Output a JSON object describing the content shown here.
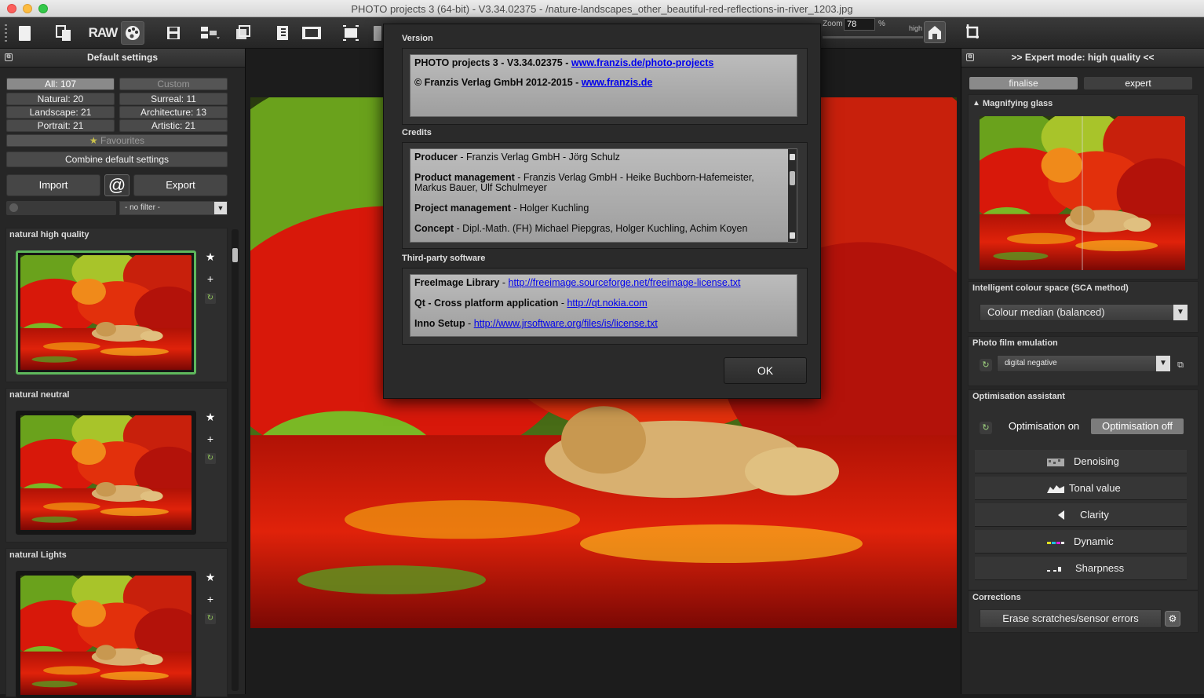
{
  "window": {
    "title": "PHOTO projects 3 (64-bit) - V3.34.02375 - /nature-landscapes_other_beautiful-red-reflections-in-river_1203.jpg"
  },
  "toolbar": {
    "raw_label": "RAW",
    "zoom_label": "Zoom",
    "zoom_value": "78",
    "zoom_unit": "%",
    "quality_label": "high",
    "icons": [
      "new-file-icon",
      "copy-icon",
      "raw-icon",
      "palette-icon",
      "save-icon",
      "export-icon",
      "share-icon",
      "layers-icon",
      "compare-icon",
      "flip-icon",
      "crop-icon",
      "house-icon",
      "rotate-icon"
    ]
  },
  "left": {
    "header": "Default settings",
    "categories": [
      {
        "label": "All: 107"
      },
      {
        "label": "Custom"
      },
      {
        "label": "Natural: 20"
      },
      {
        "label": "Surreal: 11"
      },
      {
        "label": "Landscape: 21"
      },
      {
        "label": "Architecture: 13"
      },
      {
        "label": "Portrait: 21"
      },
      {
        "label": "Artistic: 21"
      }
    ],
    "favourites": "Favourites",
    "combine": "Combine default settings",
    "import": "Import",
    "at": "@",
    "export": "Export",
    "filter": "- no filter -",
    "presets": [
      {
        "title": "natural high quality"
      },
      {
        "title": "natural neutral"
      },
      {
        "title": "natural Lights"
      }
    ]
  },
  "dialog": {
    "version_title": "Version",
    "version_line1_text": "PHOTO projects 3 - V3.34.02375 - ",
    "version_line1_link": "www.franzis.de/photo-projects",
    "version_line2_text": "© Franzis Verlag GmbH 2012-2015 - ",
    "version_line2_link": "www.franzis.de",
    "credits_title": "Credits",
    "credits": [
      {
        "role": "Producer",
        "names": " - Franzis Verlag GmbH - Jörg Schulz"
      },
      {
        "role": "Product management",
        "names": " - Franzis Verlag GmbH - Heike Buchborn-Hafemeister,",
        "names2": "Markus Bauer, Ulf Schulmeyer"
      },
      {
        "role": "Project management",
        "names": " - Holger Kuchling"
      },
      {
        "role": "Concept",
        "names": " - Dipl.-Math. (FH) Michael Piepgras, Holger Kuchling, Achim Koyen"
      }
    ],
    "third_party_title": "Third-party software",
    "third_party": [
      {
        "name": "FreeImage Library",
        "sep": " - ",
        "link": "http://freeimage.sourceforge.net/freeimage-license.txt"
      },
      {
        "name": "Qt - Cross platform application",
        "sep": " - ",
        "link": "http://qt.nokia.com"
      },
      {
        "name": "Inno Setup",
        "sep": " - ",
        "link": "http://www.jrsoftware.org/files/is/license.txt"
      }
    ],
    "ok": "OK"
  },
  "right": {
    "header": ">> Expert mode: high quality <<",
    "finalise": "finalise",
    "expert": "expert",
    "magnifying": "Magnifying glass",
    "colour_space_title": "Intelligent colour space (SCA method)",
    "colour_space_value": "Colour median (balanced)",
    "film_title": "Photo film emulation",
    "film_value": "digital negative",
    "opt_title": "Optimisation assistant",
    "opt_on": "Optimisation on",
    "opt_off": "Optimisation off",
    "tools": [
      {
        "label": "Denoising"
      },
      {
        "label": "Tonal value"
      },
      {
        "label": "Clarity"
      },
      {
        "label": "Dynamic"
      },
      {
        "label": "Sharpness"
      }
    ],
    "corrections_title": "Corrections",
    "erase": "Erase scratches/sensor errors"
  },
  "colors": {
    "selected_preset_border": "#5eb85c",
    "link": "#0000ee",
    "accent_red": "#d0150c"
  }
}
